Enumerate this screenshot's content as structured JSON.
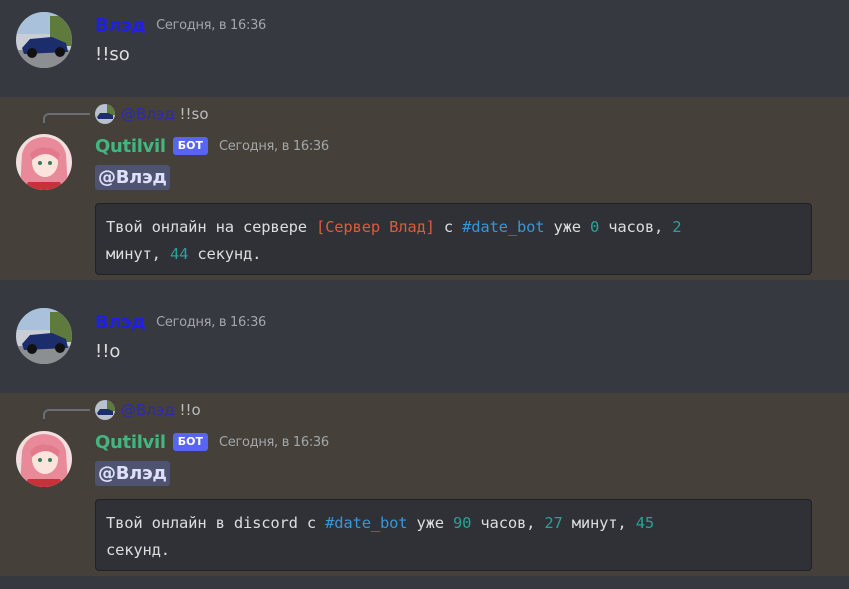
{
  "messages": [
    {
      "author": "Влэд",
      "timestamp": "Сегодня, в 16:36",
      "content": "!!so"
    },
    {
      "reply": {
        "author": "@Влэд",
        "text": "!!so"
      },
      "author": "Qutilvil",
      "bot_tag": "БОТ",
      "timestamp": "Сегодня, в 16:36",
      "mention": "@Влэд",
      "code": {
        "p1": "Твой онлайн на сервере ",
        "server": "[Сервер Влад]",
        "p2": " с ",
        "tag": "#date_bot",
        "p3": " уже ",
        "hours": "0",
        "p4": " часов, ",
        "minutes": "2",
        "p5": "минут, ",
        "seconds": "44",
        "p6": " секунд."
      }
    },
    {
      "author": "Влэд",
      "timestamp": "Сегодня, в 16:36",
      "content": "!!o"
    },
    {
      "reply": {
        "author": "@Влэд",
        "text": "!!o"
      },
      "author": "Qutilvil",
      "bot_tag": "БОТ",
      "timestamp": "Сегодня, в 16:36",
      "mention": "@Влэд",
      "code": {
        "p1": "Твой онлайн в discord с ",
        "tag": "#date_bot",
        "p2": " уже ",
        "hours": "90",
        "p3": " часов, ",
        "minutes": "27",
        "p4": " минут, ",
        "seconds": "45",
        "p5": "секунд."
      }
    }
  ],
  "colors": {
    "background": "#36393f",
    "mention_highlight": "#45413a",
    "user_name": "#1f1fe6",
    "bot_name": "#43b581",
    "bot_tag": "#5865f2"
  }
}
